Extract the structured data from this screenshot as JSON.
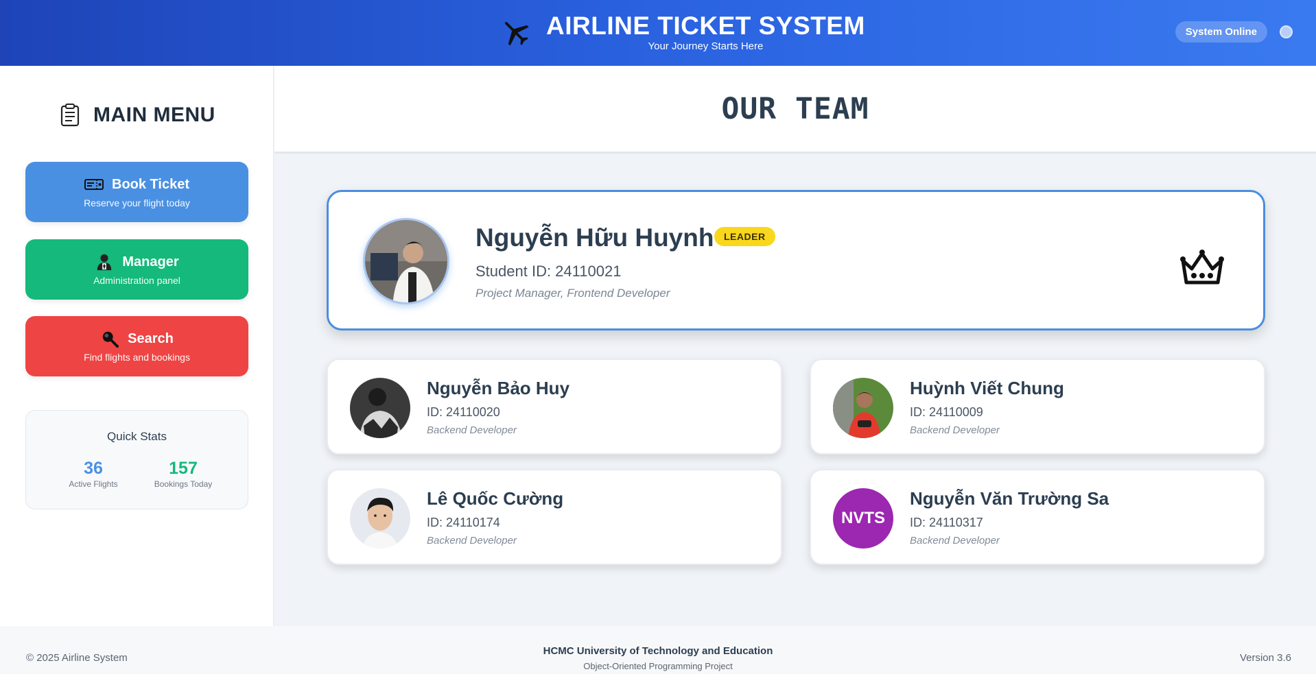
{
  "header": {
    "title": "AIRLINE TICKET SYSTEM",
    "subtitle": "Your Journey Starts Here",
    "status_label": "System Online",
    "icon": "airplane-icon"
  },
  "sidebar": {
    "title": "MAIN MENU",
    "icon": "clipboard-icon",
    "buttons": [
      {
        "label": "Book Ticket",
        "desc": "Reserve your flight today",
        "icon": "ticket-icon",
        "color": "#4a90e2"
      },
      {
        "label": "Manager",
        "desc": "Administration panel",
        "icon": "manager-icon",
        "color": "#14b97b"
      },
      {
        "label": "Search",
        "desc": "Find flights and bookings",
        "icon": "magnifier-icon",
        "color": "#ef4444"
      }
    ],
    "stats": {
      "title": "Quick Stats",
      "items": [
        {
          "value": "36",
          "label": "Active Flights"
        },
        {
          "value": "157",
          "label": "Bookings Today"
        }
      ]
    }
  },
  "main": {
    "title": "OUR TEAM",
    "leader": {
      "name": "Nguyễn Hữu Huynh",
      "badge": "LEADER",
      "student_id": "Student ID: 24110021",
      "role": "Project Manager, Frontend Developer",
      "icon": "crown-icon"
    },
    "members": [
      {
        "name": "Nguyễn Bảo Huy",
        "id": "ID: 24110020",
        "role": "Backend Developer"
      },
      {
        "name": "Huỳnh Viết Chung",
        "id": "ID: 24110009",
        "role": "Backend Developer"
      },
      {
        "name": "Lê Quốc Cường",
        "id": "ID: 24110174",
        "role": "Backend Developer"
      },
      {
        "name": "Nguyễn Văn Trường Sa",
        "id": "ID: 24110317",
        "role": "Backend Developer",
        "initials": "NVTS",
        "avatar_color": "#9c27b0"
      }
    ]
  },
  "footer": {
    "copyright": "© 2025 Airline System",
    "university": "HCMC University of Technology and Education",
    "project": "Object-Oriented Programming Project",
    "version": "Version 3.6"
  }
}
